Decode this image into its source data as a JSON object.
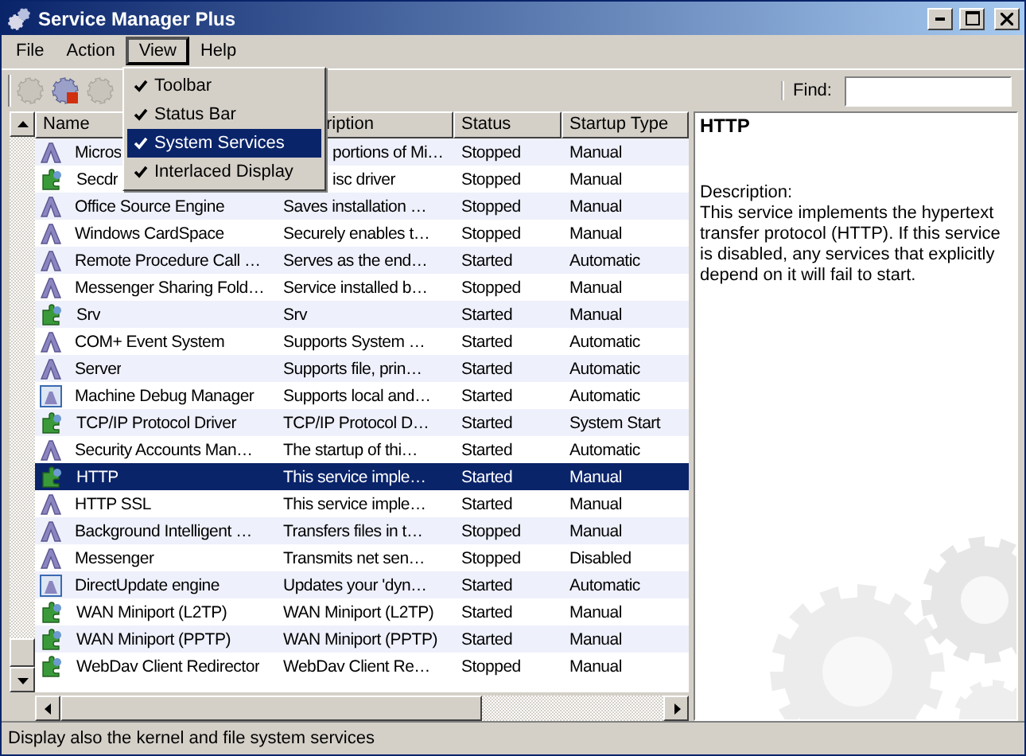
{
  "window": {
    "title": "Service Manager Plus"
  },
  "menu_bar": [
    {
      "label": "File",
      "selected": false
    },
    {
      "label": "Action",
      "selected": false
    },
    {
      "label": "View",
      "selected": true
    },
    {
      "label": "Help",
      "selected": false
    }
  ],
  "view_menu": {
    "items": [
      {
        "label": "Toolbar",
        "checked": true,
        "selected": false
      },
      {
        "label": "Status Bar",
        "checked": true,
        "selected": false
      },
      {
        "label": "System Services",
        "checked": true,
        "selected": true
      },
      {
        "label": "Interlaced Display",
        "checked": true,
        "selected": false
      }
    ]
  },
  "toolbar": {
    "buttons": [
      {
        "disabled": true
      },
      {
        "disabled": false
      },
      {
        "disabled": true
      }
    ],
    "find": {
      "label": "Find:"
    }
  },
  "table": {
    "columns": [
      "Name",
      "ription",
      "Status",
      "Startup Type"
    ],
    "rows": [
      {
        "kind": "service",
        "name": "Micros",
        "description": "portions of Mi…",
        "status": "Stopped",
        "startup_type": "Manual",
        "selected": false
      },
      {
        "kind": "driver",
        "name": "Secdr",
        "description": "isc driver",
        "status": "Stopped",
        "startup_type": "Manual",
        "selected": false
      },
      {
        "kind": "service",
        "name": "Office Source Engine",
        "description": "Saves installation …",
        "status": "Stopped",
        "startup_type": "Manual",
        "selected": false
      },
      {
        "kind": "service",
        "name": "Windows CardSpace",
        "description": "Securely enables t…",
        "status": "Stopped",
        "startup_type": "Manual",
        "selected": false
      },
      {
        "kind": "service",
        "name": "Remote Procedure Call …",
        "description": "Serves as the end…",
        "status": "Started",
        "startup_type": "Automatic",
        "selected": false
      },
      {
        "kind": "service",
        "name": "Messenger Sharing Fold…",
        "description": "Service installed b…",
        "status": "Stopped",
        "startup_type": "Manual",
        "selected": false
      },
      {
        "kind": "driver",
        "name": "Srv",
        "description": "Srv",
        "status": "Started",
        "startup_type": "Manual",
        "selected": false
      },
      {
        "kind": "service",
        "name": "COM+ Event System",
        "description": "Supports System …",
        "status": "Started",
        "startup_type": "Automatic",
        "selected": false
      },
      {
        "kind": "service",
        "name": "Server",
        "description": "Supports file, prin…",
        "status": "Started",
        "startup_type": "Automatic",
        "selected": false
      },
      {
        "kind": "application",
        "name": "Machine Debug Manager",
        "description": "Supports local and…",
        "status": "Started",
        "startup_type": "Automatic",
        "selected": false
      },
      {
        "kind": "driver",
        "name": "TCP/IP Protocol Driver",
        "description": "TCP/IP Protocol D…",
        "status": "Started",
        "startup_type": "System Start",
        "selected": false
      },
      {
        "kind": "service",
        "name": "Security Accounts Man…",
        "description": "The startup of thi…",
        "status": "Started",
        "startup_type": "Automatic",
        "selected": false
      },
      {
        "kind": "driver",
        "name": "HTTP",
        "description": "This service imple…",
        "status": "Started",
        "startup_type": "Manual",
        "selected": true
      },
      {
        "kind": "service",
        "name": "HTTP SSL",
        "description": "This service imple…",
        "status": "Started",
        "startup_type": "Manual",
        "selected": false
      },
      {
        "kind": "service",
        "name": "Background Intelligent …",
        "description": "Transfers files in t…",
        "status": "Stopped",
        "startup_type": "Manual",
        "selected": false
      },
      {
        "kind": "service",
        "name": "Messenger",
        "description": "Transmits net sen…",
        "status": "Stopped",
        "startup_type": "Disabled",
        "selected": false
      },
      {
        "kind": "application",
        "name": "DirectUpdate engine",
        "description": "Updates your 'dyn…",
        "status": "Started",
        "startup_type": "Automatic",
        "selected": false
      },
      {
        "kind": "driver",
        "name": "WAN Miniport (L2TP)",
        "description": "WAN Miniport (L2TP)",
        "status": "Started",
        "startup_type": "Manual",
        "selected": false
      },
      {
        "kind": "driver",
        "name": "WAN Miniport (PPTP)",
        "description": "WAN Miniport (PPTP)",
        "status": "Started",
        "startup_type": "Manual",
        "selected": false
      },
      {
        "kind": "driver",
        "name": "WebDav Client Redirector",
        "description": "WebDav Client Re…",
        "status": "Stopped",
        "startup_type": "Manual",
        "selected": false
      }
    ]
  },
  "details": {
    "title": "HTTP",
    "label": "Description:",
    "text": "This service implements the hypertext transfer protocol (HTTP). If this service is disabled, any services that explicitly depend on it will fail to start."
  },
  "status_bar": "Display also the kernel and file system services"
}
